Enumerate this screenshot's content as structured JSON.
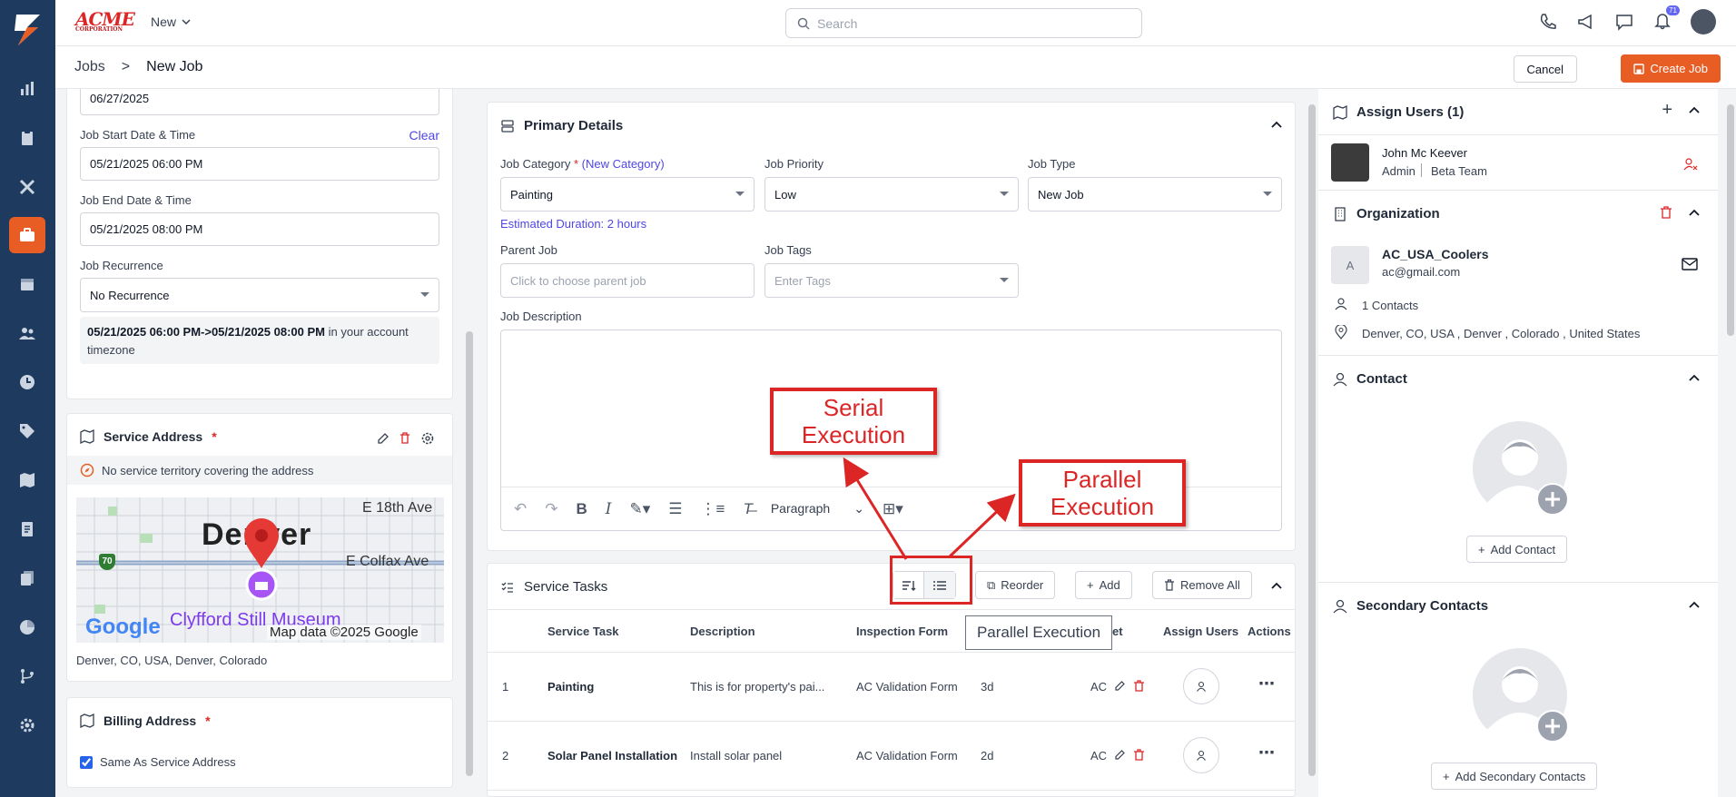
{
  "topbar": {
    "brand": "ACME",
    "brand_sub": "CORPORATION",
    "new_label": "New",
    "search_placeholder": "Search",
    "notification_count": "71"
  },
  "breadcrumb": {
    "parent": "Jobs",
    "separator": ">",
    "current": "New Job"
  },
  "actions": {
    "cancel": "Cancel",
    "create": "Create Job"
  },
  "left": {
    "date_value": "06/27/2025",
    "start_label": "Job Start Date & Time",
    "clear_label": "Clear",
    "start_value": "05/21/2025 06:00 PM",
    "end_label": "Job End Date & Time",
    "end_value": "05/21/2025 08:00 PM",
    "recurrence_label": "Job Recurrence",
    "recurrence_value": "No Recurrence",
    "tz_bold": "05/21/2025 06:00 PM->05/21/2025 08:00 PM",
    "tz_rest": "in your account timezone",
    "service_title": "Service Address",
    "territory_note": "No service territory covering the address",
    "map": {
      "city": "Denver",
      "street1": "E 18th Ave",
      "street2": "E Colfax Ave",
      "shield": "70",
      "poi": "Clyfford Still Museum",
      "attribution": "Map data ©2025 Google",
      "google": "Google"
    },
    "address_line": "Denver, CO, USA, Denver, Colorado",
    "billing_title": "Billing Address",
    "same_as_service": "Same As Service Address"
  },
  "primary": {
    "title": "Primary Details",
    "category_label": "Job Category",
    "new_category": "(New Category)",
    "category_value": "Painting",
    "duration": "Estimated Duration: 2 hours",
    "priority_label": "Job Priority",
    "priority_value": "Low",
    "type_label": "Job Type",
    "type_value": "New Job",
    "parent_label": "Parent Job",
    "parent_placeholder": "Click to choose parent job",
    "tags_label": "Job Tags",
    "tags_placeholder": "Enter Tags",
    "desc_label": "Job Description",
    "paragraph": "Paragraph"
  },
  "tasks": {
    "title": "Service Tasks",
    "reorder": "Reorder",
    "add": "Add",
    "remove_all": "Remove All",
    "columns": [
      "Service Task",
      "Description",
      "Inspection Form",
      "et",
      "Assign Users",
      "Actions"
    ],
    "rows": [
      {
        "num": "1",
        "name": "Painting",
        "desc": "This is for property's pai...",
        "form": "AC Validation Form",
        "dur": "3d",
        "code": "AC"
      },
      {
        "num": "2",
        "name": "Solar Panel Installation",
        "desc": "Install solar panel",
        "form": "AC Validation Form",
        "dur": "2d",
        "code": "AC"
      }
    ],
    "tooltip": "Parallel Execution"
  },
  "annotations": {
    "serial": "Serial Execution",
    "parallel": "Parallel Execution"
  },
  "right": {
    "assign_title": "Assign Users (1)",
    "user_name": "John Mc Keever",
    "user_role": "Admin",
    "user_team": "Beta Team",
    "org_title": "Organization",
    "org_initial": "A",
    "org_name": "AC_USA_Coolers",
    "org_email": "ac@gmail.com",
    "contacts_count": "1 Contacts",
    "org_address": "Denver, CO, USA , Denver , Colorado , United States",
    "contact_title": "Contact",
    "add_contact": "Add Contact",
    "secondary_title": "Secondary Contacts",
    "add_secondary": "Add Secondary Contacts"
  },
  "colors": {
    "brand_orange": "#e85d24",
    "sidebar": "#1e3a5f",
    "annotation_red": "#dc2626",
    "link": "#4f46e5"
  }
}
